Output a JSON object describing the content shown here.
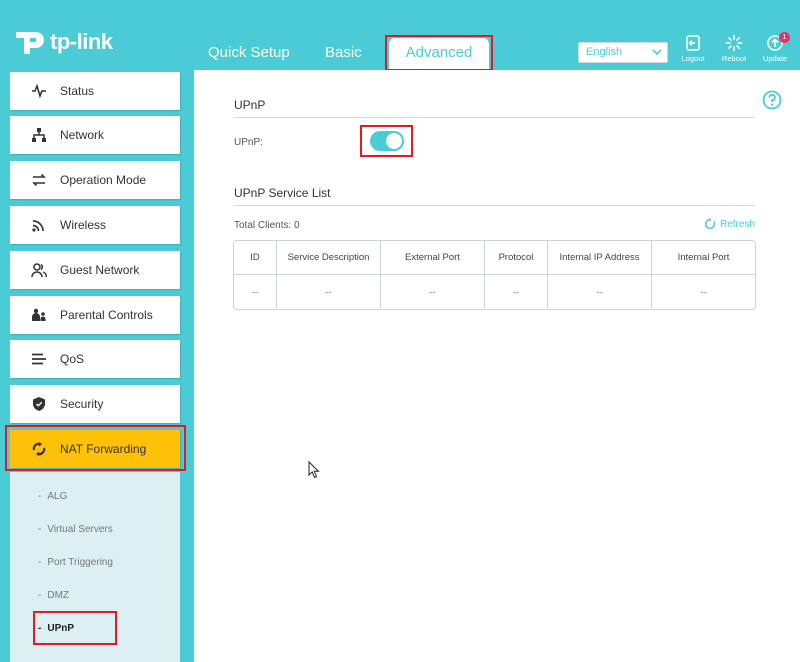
{
  "brand": {
    "name": "tp-link"
  },
  "colors": {
    "accent": "#4acbd6",
    "active_nav": "#ffc107",
    "highlight": "#e01b24",
    "badge": "#e0356a"
  },
  "top_tabs": {
    "quick_setup": "Quick Setup",
    "basic": "Basic",
    "advanced": "Advanced"
  },
  "header": {
    "language": "English",
    "logout": "Logout",
    "reboot": "Reboot",
    "update": "Update",
    "update_badge": "1"
  },
  "sidebar": {
    "items": [
      {
        "label": "Status",
        "icon": "pulse-icon"
      },
      {
        "label": "Network",
        "icon": "network-icon"
      },
      {
        "label": "Operation Mode",
        "icon": "swap-icon"
      },
      {
        "label": "Wireless",
        "icon": "wifi-icon"
      },
      {
        "label": "Guest Network",
        "icon": "guest-icon"
      },
      {
        "label": "Parental Controls",
        "icon": "parental-icon"
      },
      {
        "label": "QoS",
        "icon": "qos-icon"
      },
      {
        "label": "Security",
        "icon": "shield-icon"
      },
      {
        "label": "NAT Forwarding",
        "icon": "nat-icon"
      }
    ],
    "sub_items": [
      "ALG",
      "Virtual Servers",
      "Port Triggering",
      "DMZ",
      "UPnP"
    ],
    "sub_dash": "-"
  },
  "main": {
    "upnp_title": "UPnP",
    "upnp_label": "UPnP:",
    "upnp_enabled": true,
    "service_list_title": "UPnP Service List",
    "total_clients_label": "Total Clients:",
    "total_clients_value": "0",
    "refresh_label": "Refresh",
    "table": {
      "headers": [
        "ID",
        "Service Description",
        "External Port",
        "Protocol",
        "Internal IP Address",
        "Internal Port"
      ],
      "rows": [
        [
          "--",
          "--",
          "--",
          "--",
          "--",
          "--"
        ]
      ]
    }
  }
}
